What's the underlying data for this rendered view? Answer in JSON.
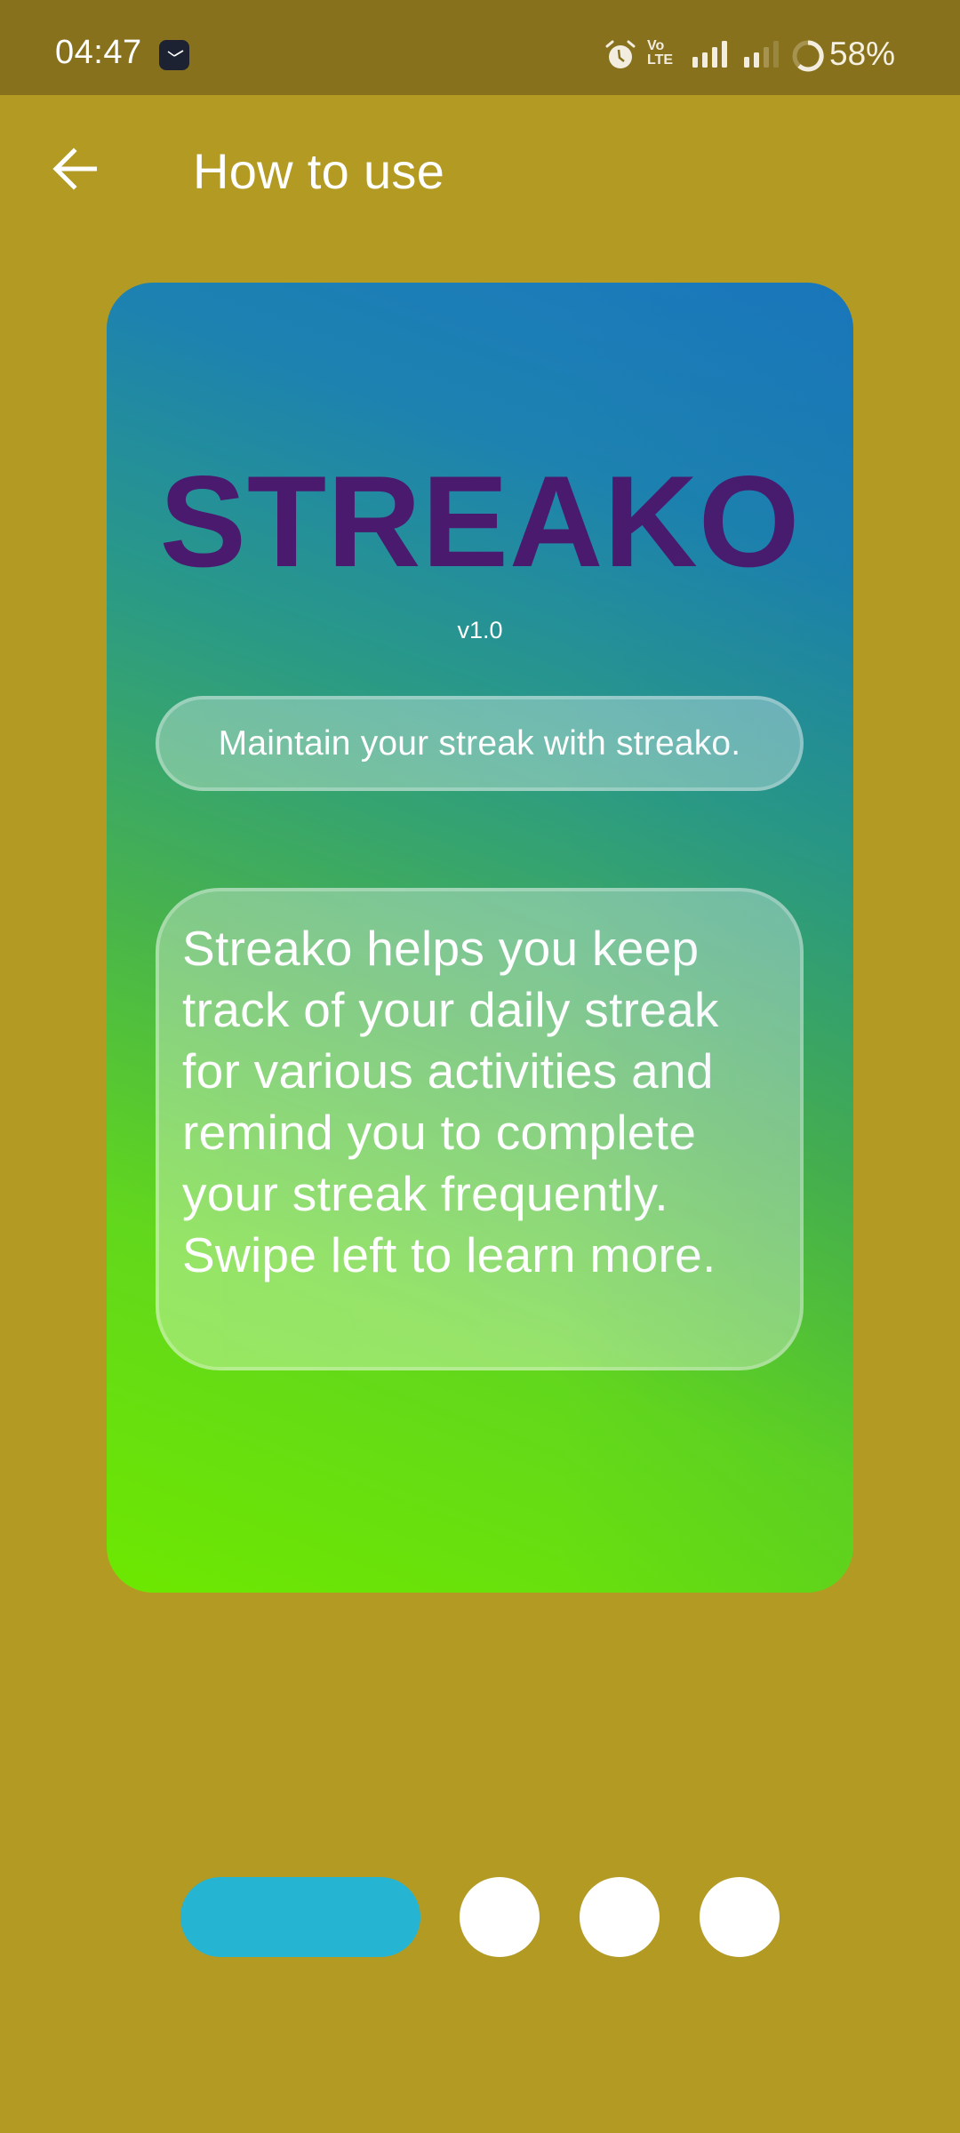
{
  "status_bar": {
    "time": "04:47",
    "notification_icons": [
      "clock-app-icon"
    ],
    "system_icons": [
      "alarm-icon",
      "volte-icon",
      "signal-sim1-icon",
      "signal-sim2-icon",
      "battery-ring-icon"
    ],
    "volte_label_top": "Vo",
    "volte_label_bottom": "LTE",
    "battery_percent": "58%",
    "battery_level": 0.58
  },
  "header": {
    "back_icon": "arrow-left-icon",
    "title": "How to use"
  },
  "onboarding_card": {
    "app_name": "STREAKO",
    "version": "v1.0",
    "tagline": "Maintain your streak with streako.",
    "description": "Streako helps you keep track of your daily streak for various activities and remind you to complete your streak frequently. Swipe left to learn more."
  },
  "page_indicator": {
    "total_pages": 4,
    "current_page": 1
  },
  "colors": {
    "background": "#b39a23",
    "status_bar": "#87711d",
    "brand_text": "#4a1a6e",
    "indicator_active": "#25b4d2",
    "indicator_inactive": "#ffffff",
    "card_gradient_top": "#1a78bf",
    "card_gradient_bottom": "#6de800"
  }
}
